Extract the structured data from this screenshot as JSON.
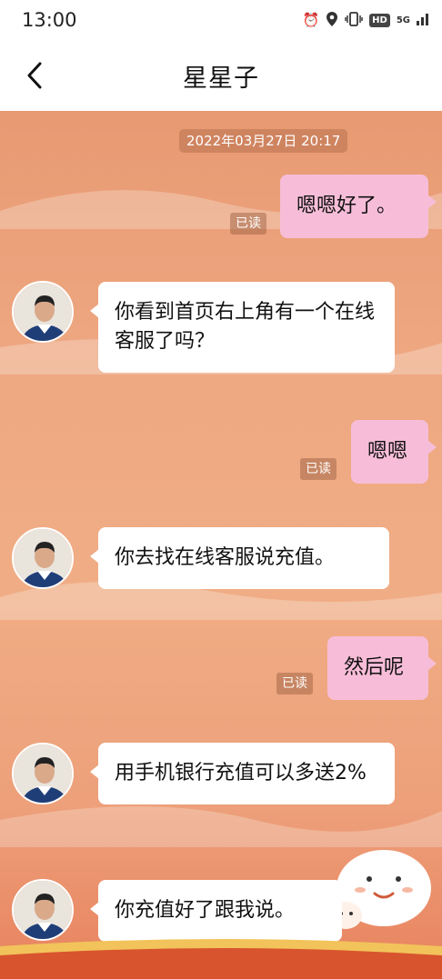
{
  "status_bar": {
    "time": "13:00",
    "hd_label": "HD",
    "network_label": "5G"
  },
  "header": {
    "title": "星星子"
  },
  "chat": {
    "timestamp": "2022年03月27日  20:17",
    "read_label": "已读",
    "messages": [
      {
        "side": "right",
        "text": "嗯嗯好了。"
      },
      {
        "side": "left",
        "text": "你看到首页右上角有一个在线客服了吗？"
      },
      {
        "side": "right",
        "text": "嗯嗯"
      },
      {
        "side": "left",
        "text": "你去找在线客服说充值。"
      },
      {
        "side": "right",
        "text": "然后呢"
      },
      {
        "side": "left",
        "text": "用手机银行充值可以多送2%"
      },
      {
        "side": "left",
        "text": "你充值好了跟我说。"
      }
    ]
  },
  "colors": {
    "accent_bubble": "#f7bdd8",
    "chat_background": "#eea882"
  }
}
